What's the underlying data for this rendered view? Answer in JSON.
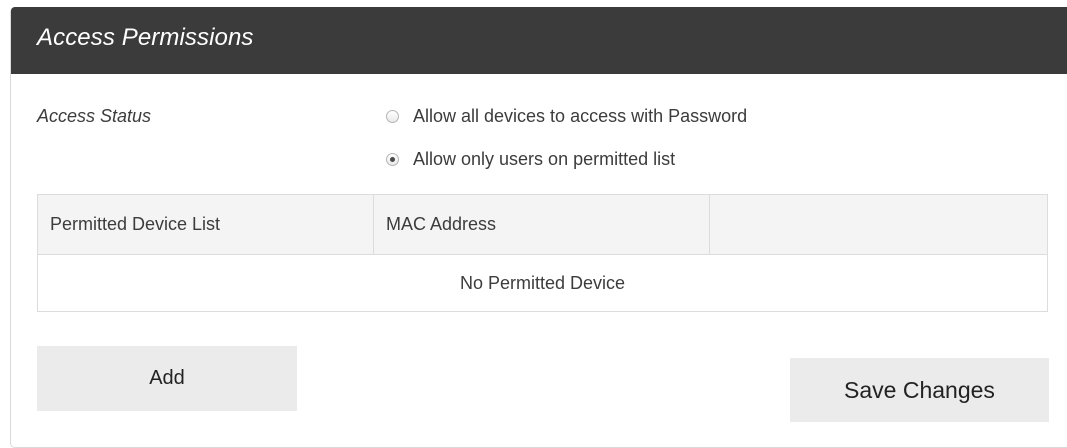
{
  "panel": {
    "title": "Access Permissions"
  },
  "access_status": {
    "label": "Access Status",
    "options": [
      {
        "label": "Allow all devices to access with Password",
        "selected": false
      },
      {
        "label": "Allow only users on permitted list",
        "selected": true
      }
    ]
  },
  "device_table": {
    "columns": [
      "Permitted Device List",
      "MAC Address",
      ""
    ],
    "empty_message": "No Permitted Device"
  },
  "buttons": {
    "add_label": "Add",
    "save_label": "Save Changes"
  }
}
